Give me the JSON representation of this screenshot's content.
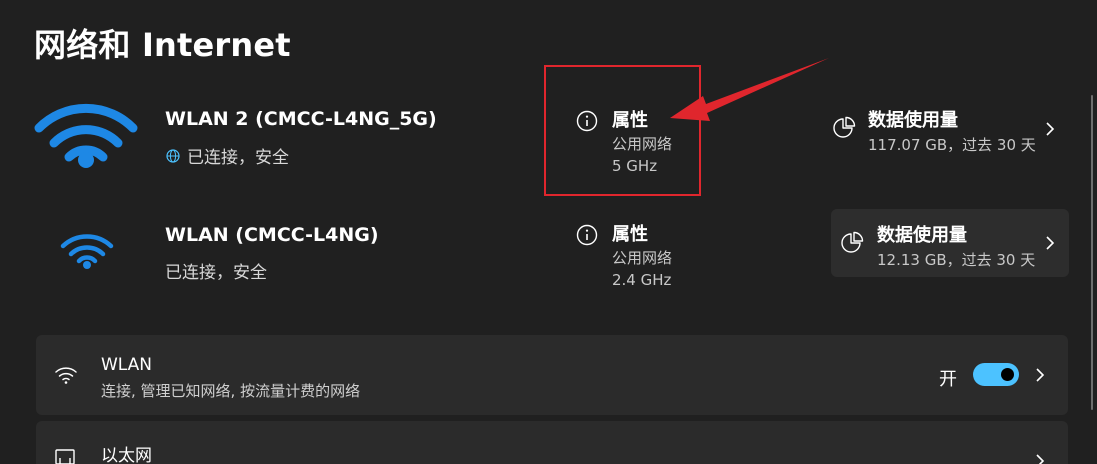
{
  "page": {
    "title": "网络和 Internet"
  },
  "networks": [
    {
      "name": "WLAN 2 (CMCC-L4NG_5G)",
      "status": "已连接，安全",
      "status_icon": "globe-icon",
      "properties": {
        "label": "属性",
        "network_type": "公用网络",
        "band": "5 GHz"
      },
      "data_usage": {
        "label": "数据使用量",
        "detail": "117.07 GB，过去 30 天"
      }
    },
    {
      "name": "WLAN (CMCC-L4NG)",
      "status": "已连接，安全",
      "properties": {
        "label": "属性",
        "network_type": "公用网络",
        "band": "2.4 GHz"
      },
      "data_usage": {
        "label": "数据使用量",
        "detail": "12.13 GB，过去 30 天"
      }
    }
  ],
  "settings": {
    "wlan": {
      "title": "WLAN",
      "subtitle": "连接, 管理已知网络, 按流量计费的网络",
      "toggle_label": "开",
      "toggle_on": true
    },
    "ethernet": {
      "title": "以太网"
    }
  },
  "colors": {
    "accent": "#4cc2ff",
    "wifi_blue": "#1e88e5",
    "annotation_red": "#e0262d",
    "background": "#202020",
    "card": "#2b2b2b"
  }
}
